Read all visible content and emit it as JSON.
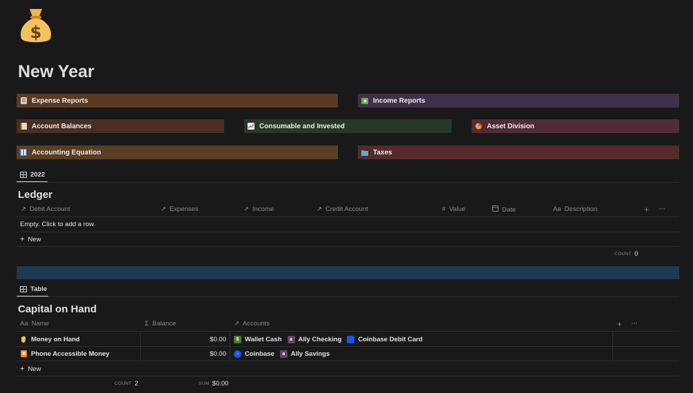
{
  "page": {
    "title": "New Year",
    "icon": "money-bag-icon"
  },
  "callouts": [
    {
      "label": "Expense Reports",
      "icon": "ledger-icon",
      "color": "#5b3a22"
    },
    {
      "label": "Income Reports",
      "icon": "dollar-banknote-icon",
      "color": "#3f3149"
    },
    {
      "label": "Account Balances",
      "icon": "notebook-icon",
      "color": "#4a2e22"
    },
    {
      "label": "Consumable and Invested",
      "icon": "chart-increasing-icon",
      "color": "#26382e"
    },
    {
      "label": "Asset Division",
      "icon": "pie-chart-icon",
      "color": "#512c36"
    },
    {
      "label": "Accounting Equation",
      "icon": "abacus-icon",
      "color": "#5a3e23"
    },
    {
      "label": "Taxes",
      "icon": "folder-icon",
      "color": "#542a2a"
    }
  ],
  "ledger": {
    "view_tab": "2022",
    "title": "Ledger",
    "columns": [
      {
        "icon": "relation-arrow-icon",
        "label": "Debit Account"
      },
      {
        "icon": "relation-arrow-icon",
        "label": "Expenses"
      },
      {
        "icon": "relation-arrow-icon",
        "label": "Income"
      },
      {
        "icon": "relation-arrow-icon",
        "label": "Credit Account"
      },
      {
        "icon": "number-hash-icon",
        "label": "Value"
      },
      {
        "icon": "calendar-icon",
        "label": "Date"
      },
      {
        "icon": "text-aa-icon",
        "label": "Description"
      }
    ],
    "empty_text": "Empty. Click to add a row.",
    "new_label": "New",
    "count_label": "COUNT",
    "count_value": "0"
  },
  "banner_color": "#1d3b53",
  "capital": {
    "view_tab": "Table",
    "title": "Capital on Hand",
    "columns": [
      {
        "icon": "text-aa-icon",
        "label": "Name"
      },
      {
        "icon": "sigma-icon",
        "label": "Balance"
      },
      {
        "icon": "relation-arrow-icon",
        "label": "Accounts"
      }
    ],
    "rows": [
      {
        "icon": "raised-hand-icon",
        "name": "Money on Hand",
        "balance": "$0.00",
        "accounts": [
          {
            "label": "Wallet Cash",
            "icon": "dollar-banknote-icon",
            "color": "#4a7a34"
          },
          {
            "label": "Ally Checking",
            "icon": "ally-logo-icon",
            "color": "#6a3f67"
          },
          {
            "label": "Coinbase Debit Card",
            "icon": "card-icon",
            "color": "#1652f0"
          }
        ]
      },
      {
        "icon": "phone-icon",
        "name": "Phone Accessible Money",
        "balance": "$0.00",
        "accounts": [
          {
            "label": "Coinbase",
            "icon": "coinbase-logo-icon",
            "color": "#1652f0"
          },
          {
            "label": "Ally Savings",
            "icon": "ally-logo-icon",
            "color": "#6a3f67"
          }
        ]
      }
    ],
    "new_label": "New",
    "count_label": "COUNT",
    "count_value": "2",
    "sum_label": "SUM",
    "sum_value": "$0.00"
  }
}
